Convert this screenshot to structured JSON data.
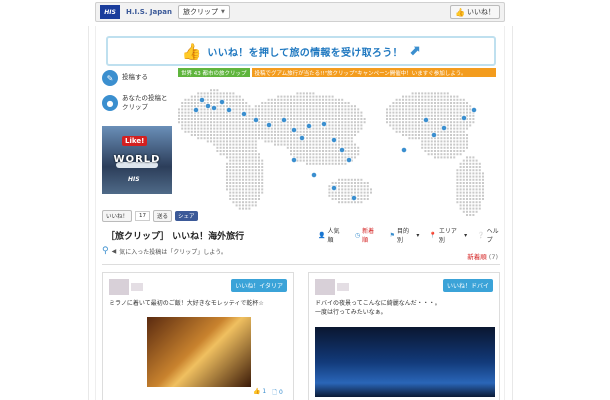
{
  "topbar": {
    "logo": "HIS",
    "page_name": "H.I.S. Japan",
    "tab_label": "旅クリップ",
    "like_label": "いいね！"
  },
  "banner": {
    "text": "いいね！を押して旅の情報を受け取ろう！"
  },
  "side_nav": [
    {
      "label": "投稿する"
    },
    {
      "label": "あなたの投稿と\nクリップ"
    }
  ],
  "promo": {
    "like_badge": "Like!",
    "world_word": "WORLD",
    "brand": "HIS"
  },
  "stripe": {
    "left": "世界 43 都市の旅クリップ",
    "right": "投稿でグアム旅行が当たる!!\"旅クリップ\"キャンペーン開催中！いますぐ参加しよう。"
  },
  "share": {
    "like": "いいね！",
    "count": "17",
    "send": "送る",
    "fb_share": "シェア"
  },
  "sort": [
    {
      "label": "人気順",
      "active": false
    },
    {
      "label": "新着順",
      "active": true
    },
    {
      "label": "目的別",
      "active": false
    },
    {
      "label": "エリア別",
      "active": false
    },
    {
      "label": "ヘルプ",
      "active": false
    }
  ],
  "title": "［旅クリップ］ いいね！海外旅行",
  "hint": "気に入った投稿は「クリップ」しよう。",
  "new_count": {
    "label": "新着順",
    "count": "(7)"
  },
  "cards": [
    {
      "tag": "いいね！イタリア",
      "text": "ミラノに着いて最初のご飯！大好きなモレッティで乾杯☆",
      "likes": "1",
      "clips": "0"
    },
    {
      "tag": "いいね！ドバイ",
      "text": "ドバイの夜景ってこんなに綺麗なんだ・・・。\n一度は行ってみたいなぁ。"
    }
  ],
  "colors": {
    "accent": "#3b8fcf",
    "green": "#5fb53d",
    "orange": "#f39c1e",
    "red": "#d42020",
    "fb_blue": "#3b5998"
  }
}
